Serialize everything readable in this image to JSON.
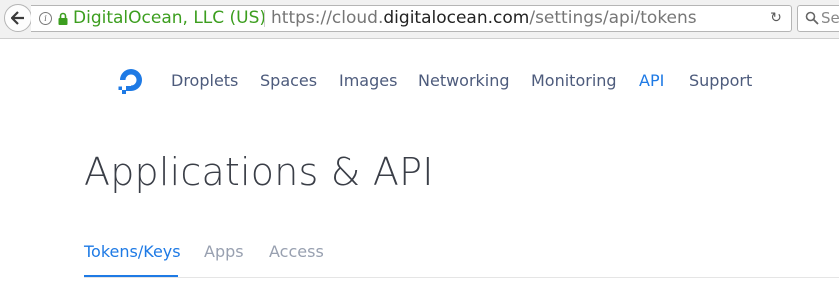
{
  "browser": {
    "org_label": "DigitalOcean, LLC (US)",
    "url_prefix": "https://cloud.",
    "url_host": "digitalocean.com",
    "url_path": "/settings/api/tokens",
    "search_placeholder": "Se",
    "org_color": "#3c9e1f"
  },
  "site": {
    "brand_color": "#1e7ae5",
    "logo_icon": "digitalocean-logo",
    "nav": [
      {
        "label": "Droplets",
        "active": false
      },
      {
        "label": "Spaces",
        "active": false
      },
      {
        "label": "Images",
        "active": false
      },
      {
        "label": "Networking",
        "active": false
      },
      {
        "label": "Monitoring",
        "active": false
      },
      {
        "label": "API",
        "active": true
      },
      {
        "label": "Support",
        "active": false
      }
    ]
  },
  "page": {
    "title": "Applications & API",
    "tabs": [
      {
        "label": "Tokens/Keys",
        "active": true
      },
      {
        "label": "Apps",
        "active": false
      },
      {
        "label": "Access",
        "active": false
      }
    ]
  }
}
